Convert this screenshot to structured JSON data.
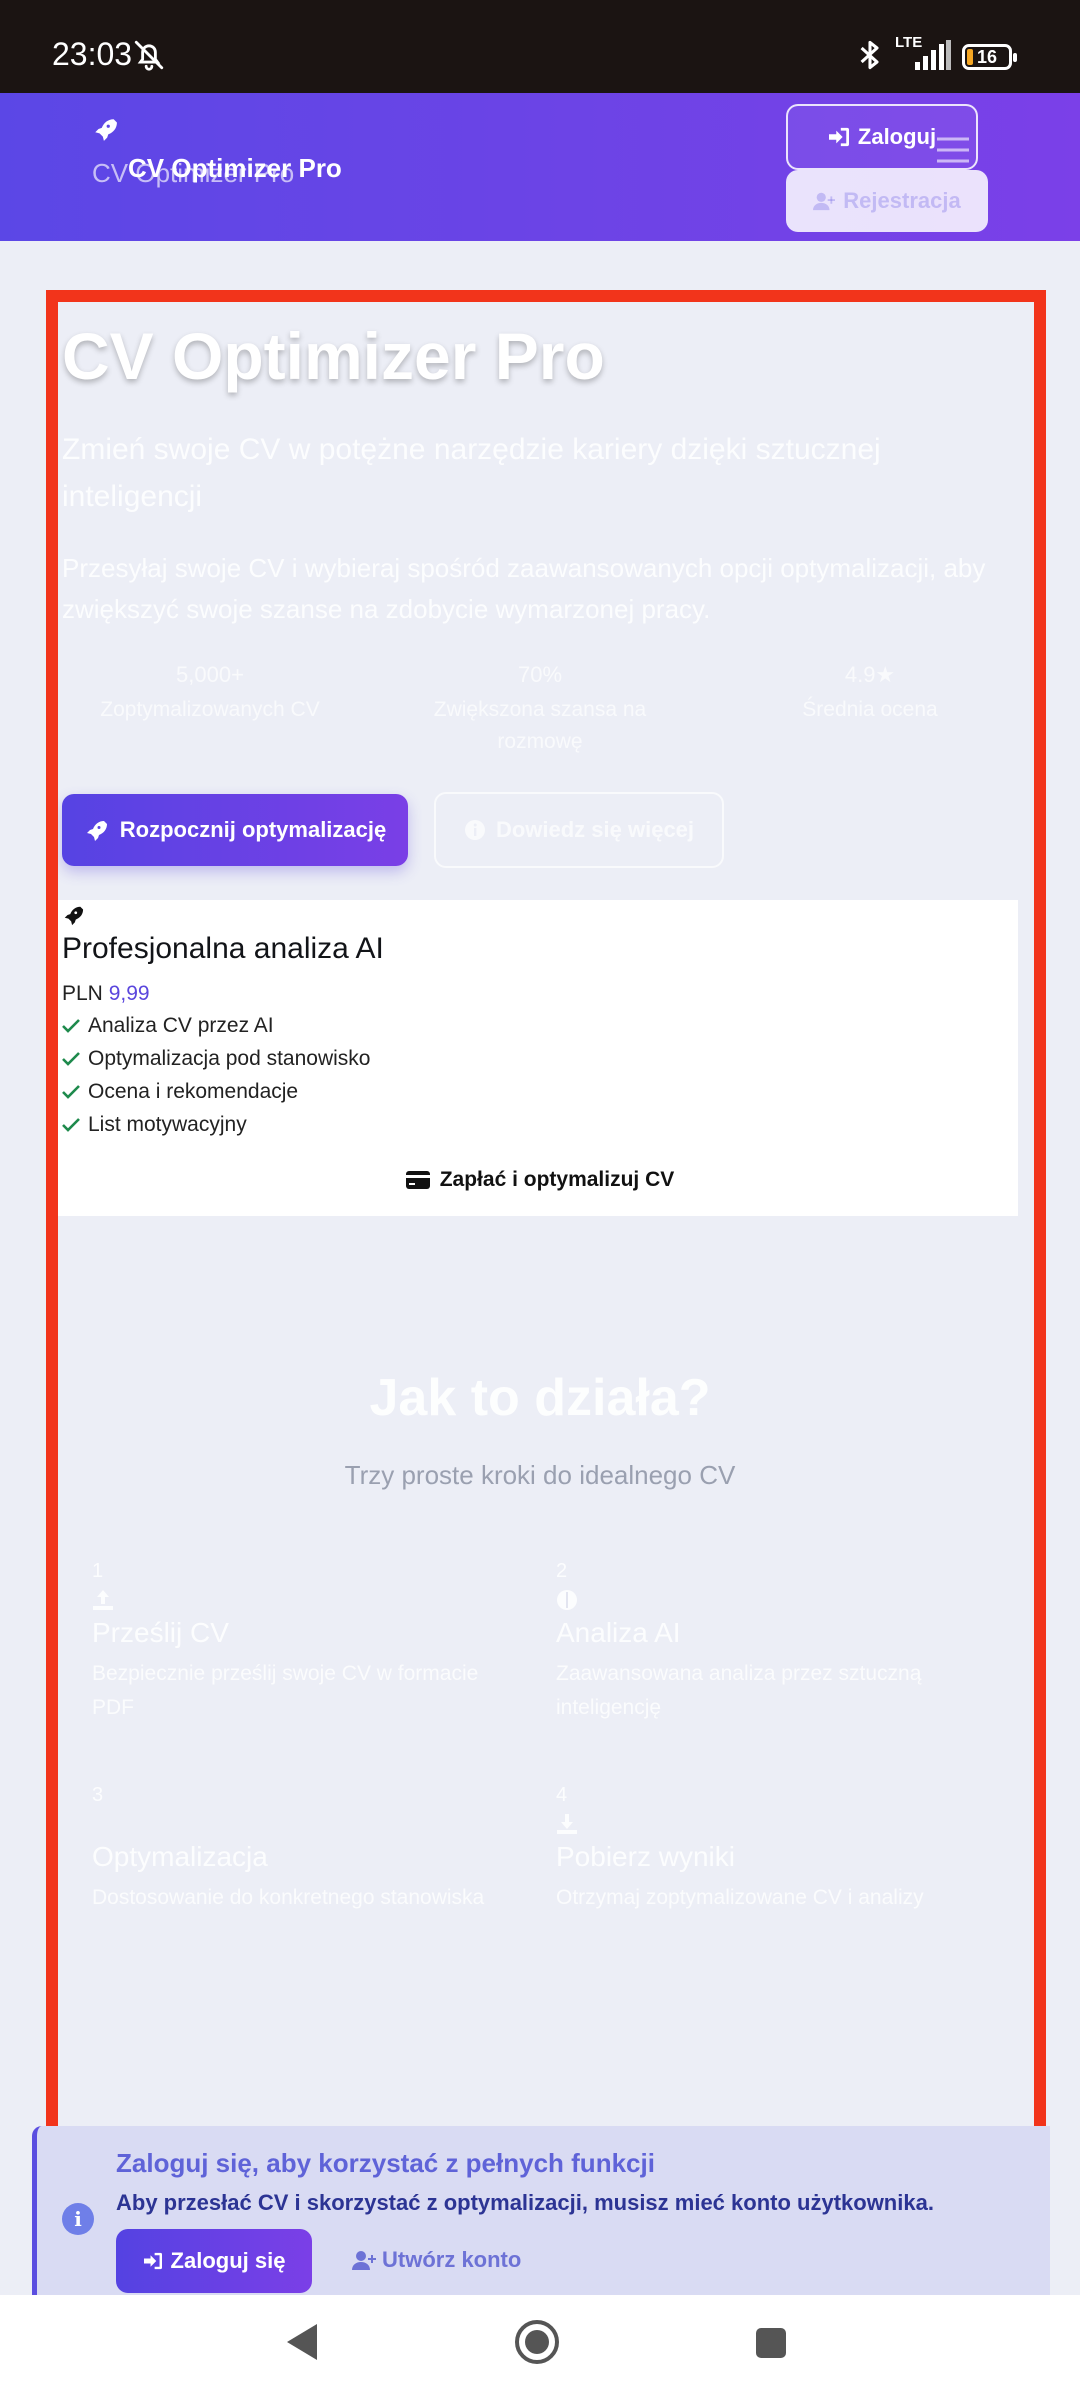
{
  "status_bar": {
    "time": "23:03",
    "network": "LTE",
    "battery": "16"
  },
  "header": {
    "brand": "CV Optimizer Pro",
    "login_label": "Zaloguj",
    "register_label": "Rejestracja"
  },
  "hero": {
    "title": "CV Optimizer Pro",
    "subtitle": "Zmień swoje CV w potężne narzędzie kariery dzięki sztucznej inteligencji",
    "description": "Przesyłaj swoje CV i wybieraj spośród zaawansowanych opcji optymalizacji, aby zwiększyć swoje szanse na zdobycie wymarzonej pracy.",
    "stats": [
      {
        "value": "5,000+",
        "label": "Zoptymalizowanych CV"
      },
      {
        "value": "70%",
        "label": "Zwiększona szansa na rozmowę"
      },
      {
        "value": "4.9★",
        "label": "Średnia ocena"
      }
    ],
    "start_label": "Rozpocznij optymalizację",
    "learn_label": "Dowiedz się więcej"
  },
  "pricing": {
    "title": "Profesjonalna analiza AI",
    "currency": "PLN",
    "amount": "9,99",
    "features": [
      "Analiza CV przez AI",
      "Optymalizacja pod stanowisko",
      "Ocena i rekomendacje",
      "List motywacyjny"
    ],
    "pay_label": "Zapłać i optymalizuj CV"
  },
  "how": {
    "title": "Jak to działa?",
    "subtitle": "Trzy proste kroki do idealnego CV",
    "steps": [
      {
        "num": "1",
        "title": "Prześlij CV",
        "desc": "Bezpiecznie prześlij swoje CV w formacie PDF",
        "icon": "upload-icon"
      },
      {
        "num": "2",
        "title": "Analiza AI",
        "desc": "Zaawansowana analiza przez sztuczną inteligencję",
        "icon": "brain-icon"
      },
      {
        "num": "3",
        "title": "Optymalizacja",
        "desc": "Dostosowanie do konkretnego stanowiska",
        "icon": "magic-icon"
      },
      {
        "num": "4",
        "title": "Pobierz wyniki",
        "desc": "Otrzymaj zoptymalizowane CV i analizy",
        "icon": "download-icon"
      }
    ]
  },
  "banner": {
    "title": "Zaloguj się, aby korzystać z pełnych funkcji",
    "text": "Aby przesłać CV i skorzystać z optymalizacji, musisz mieć konto użytkownika.",
    "login_label": "Zaloguj się",
    "create_label": "Utwórz konto"
  },
  "colors": {
    "accent": "#5b47e6",
    "highlight": "#f2341b",
    "check": "#1e8a4c"
  }
}
